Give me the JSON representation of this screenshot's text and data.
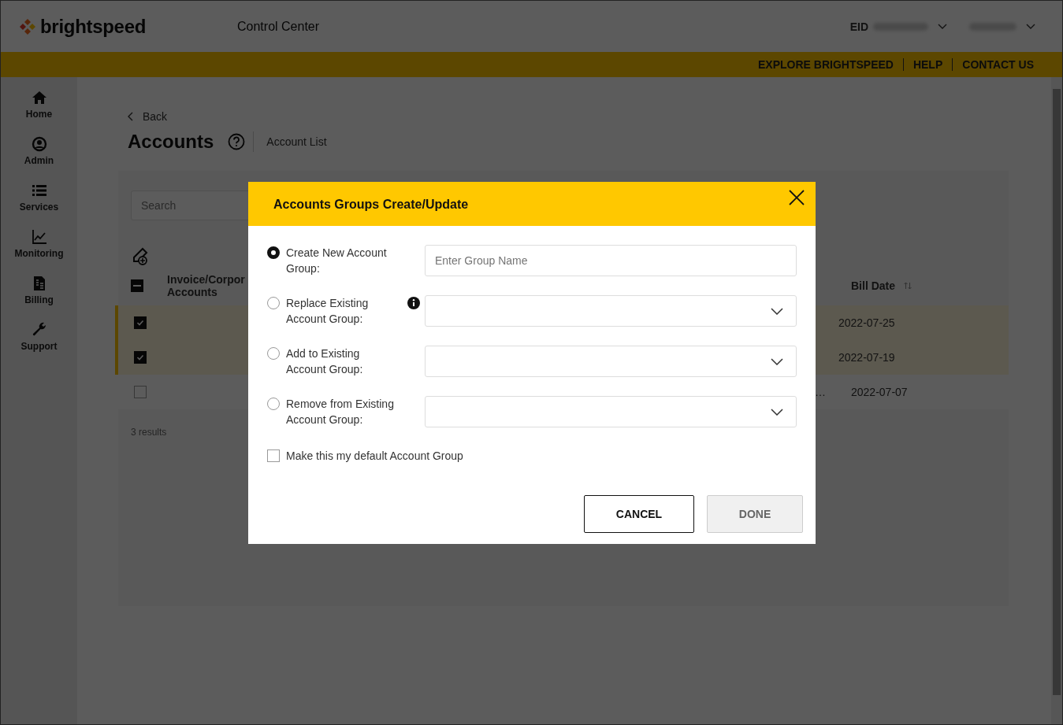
{
  "header": {
    "logo": "brightspeed",
    "title": "Control Center",
    "eid_label": "EID"
  },
  "top_links": [
    "EXPLORE BRIGHTSPEED",
    "HELP",
    "CONTACT US"
  ],
  "sidebar": {
    "items": [
      {
        "label": "Home"
      },
      {
        "label": "Admin"
      },
      {
        "label": "Services"
      },
      {
        "label": "Monitoring"
      },
      {
        "label": "Billing"
      },
      {
        "label": "Support"
      }
    ]
  },
  "page": {
    "back": "Back",
    "title": "Accounts",
    "breadcrumb": "Account List"
  },
  "search": {
    "placeholder": "Search"
  },
  "table": {
    "select_all_indeterminate": true,
    "columns": [
      {
        "lines": [
          "Invoice/Corpor",
          "Accounts"
        ]
      },
      {
        "lines": [
          "Bill Date"
        ]
      }
    ],
    "rows": [
      {
        "checked": true,
        "cell": "",
        "bill_date": "2022-07-25"
      },
      {
        "checked": true,
        "cell": "",
        "bill_date": "2022-07-19"
      },
      {
        "checked": false,
        "cell": "…",
        "bill_date": "2022-07-07"
      }
    ]
  },
  "results": "3 results",
  "modal": {
    "title": "Accounts Groups Create/Update",
    "options": [
      {
        "label": "Create New Account Group:",
        "selected": true,
        "info": false,
        "field": {
          "kind": "text",
          "placeholder": "Enter Group Name"
        }
      },
      {
        "label": "Replace Existing Account Group:",
        "selected": false,
        "info": true,
        "field": {
          "kind": "select"
        }
      },
      {
        "label": "Add to Existing Account Group:",
        "selected": false,
        "info": false,
        "field": {
          "kind": "select"
        }
      },
      {
        "label": "Remove from Existing Account Group:",
        "selected": false,
        "info": false,
        "field": {
          "kind": "select"
        }
      }
    ],
    "default_checkbox": {
      "label": "Make this my default Account Group",
      "checked": false
    },
    "buttons": [
      {
        "label": "CANCEL",
        "disabled": false
      },
      {
        "label": "DONE",
        "disabled": true
      }
    ]
  }
}
